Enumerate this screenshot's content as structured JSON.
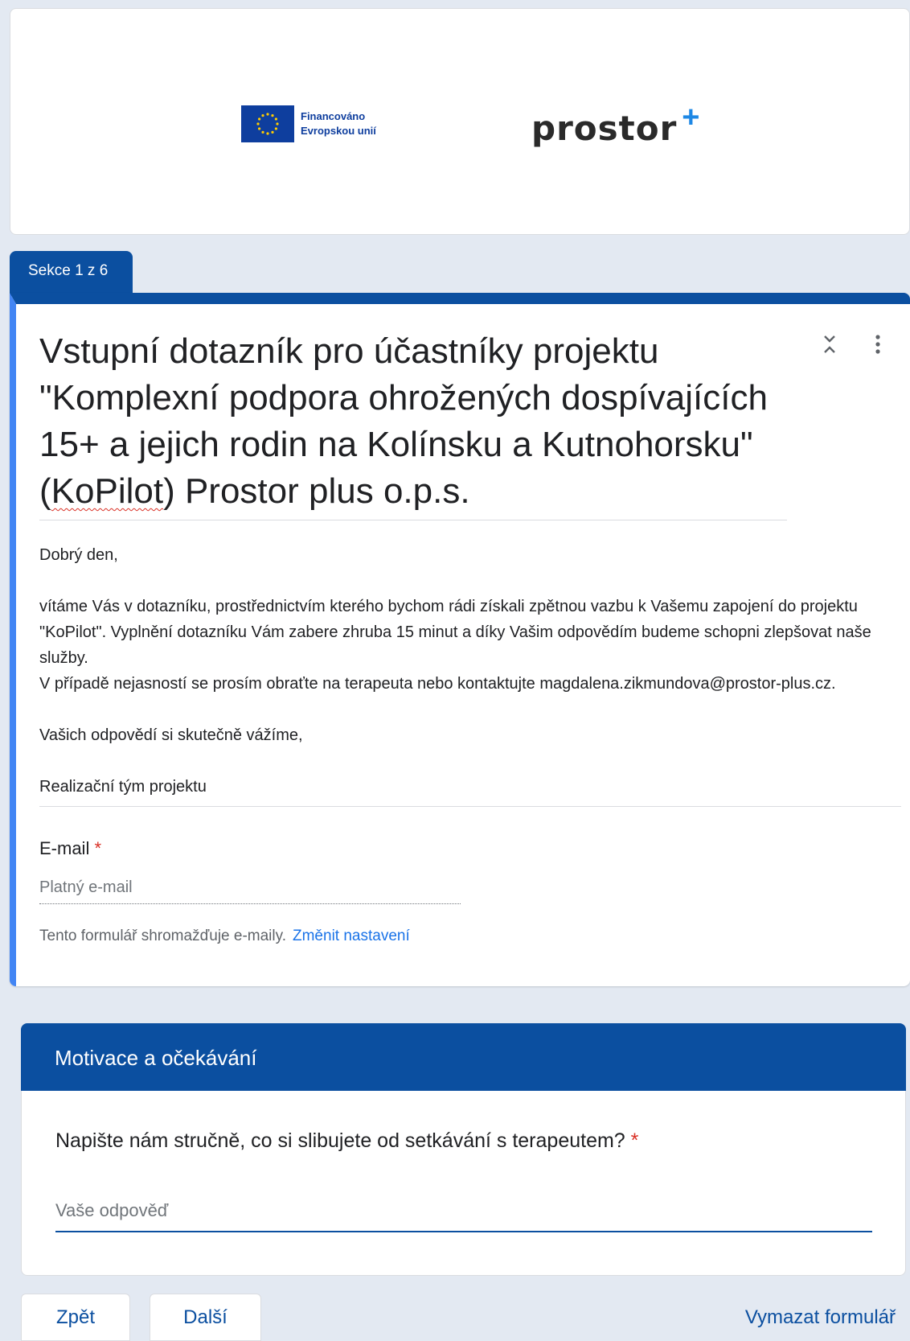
{
  "header": {
    "eu_logo_line1": "Financováno",
    "eu_logo_line2": "Evropskou unií",
    "brand_name": "prostor",
    "brand_plus": "+"
  },
  "section_tab": "Sekce 1 z 6",
  "form": {
    "title_part1": "Vstupní dotazník pro účastníky projektu \"Komplexní podpora ohrožených dospívajících 15+ a jejich rodin na Kolínsku a Kutnohorsku\" (",
    "title_squiggle": "KoPilot",
    "title_part2": ") Prostor plus o.p.s.",
    "description": {
      "greeting": "Dobrý den,",
      "para1": "vítáme Vás v dotazníku, prostřednictvím kterého bychom rádi získali zpětnou vazbu k Vašemu zapojení do projektu  \"KoPilot\". Vyplnění dotazníku Vám zabere zhruba 15 minut a díky Vašim odpovědím budeme schopni zlepšovat naše služby.",
      "para2": "V případě nejasností se prosím obraťte na terapeuta nebo kontaktujte magdalena.zikmundova@prostor-plus.cz.",
      "closing": "Vašich odpovědí si skutečně vážíme,",
      "signature": "Realizační tým projektu"
    },
    "email_label": "E-mail",
    "required_mark": "*",
    "email_placeholder": "Platný e-mail",
    "collect_note": "Tento formulář shromažďuje e-maily.",
    "change_settings": "Změnit nastavení"
  },
  "section2": {
    "title": "Motivace a očekávání",
    "question": "Napište nám stručně, co si slibujete od setkávání s terapeutem?",
    "required_mark": "*",
    "answer_placeholder": "Vaše odpověď"
  },
  "nav": {
    "back": "Zpět",
    "next": "Další",
    "clear": "Vymazat formulář"
  },
  "colors": {
    "accent": "#0b4fa0",
    "left_bar": "#4285f4",
    "required": "#d93025",
    "link": "#1a73e8",
    "eu_blue": "#0e3e9e",
    "plus_blue": "#1e88e5",
    "background": "#e3e9f2"
  },
  "icons": {
    "collapse": "collapse-icon",
    "more": "more-vert-icon"
  }
}
